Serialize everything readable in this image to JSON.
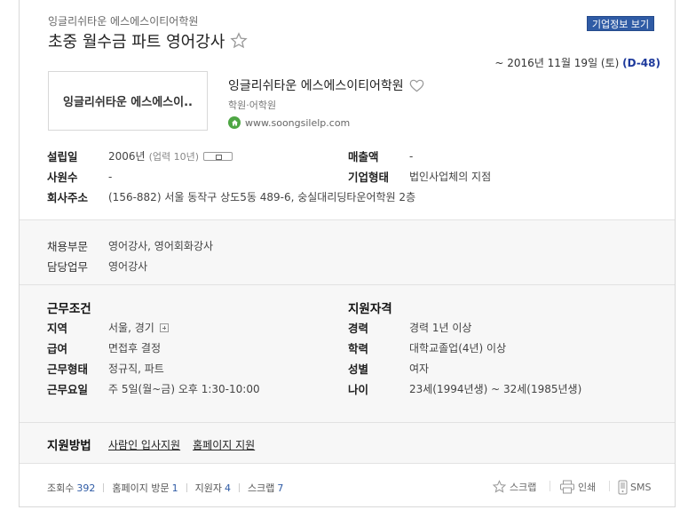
{
  "header": {
    "company_small": "잉글리쉬타운 에스에스이티어학원",
    "job_title": "초중 월수금 파트 영어강사",
    "company_info_button": "기업정보 보기",
    "deadline_prefix": "~ 2016년 11월 19일 (토)",
    "dday": "(D-48)"
  },
  "company": {
    "logo_text": "잉글리쉬타운 에스에스이..",
    "name": "잉글리쉬타운 에스에스이티어학원",
    "category": "학원·어학원",
    "website": "www.soongsilelp.com"
  },
  "overview": {
    "founded_label": "설립일",
    "founded_value": "2006년",
    "founded_years": "(업력 10년)",
    "revenue_label": "매출액",
    "revenue_value": "-",
    "employees_label": "사원수",
    "employees_value": "-",
    "corp_type_label": "기업형태",
    "corp_type_value": "법인사업체의 지점",
    "address_label": "회사주소",
    "address_value": "(156-882) 서울 동작구 상도5동 489-6, 숭실대리딩타운어학원 2층"
  },
  "duty": {
    "dept_label": "채용부문",
    "dept_value": "영어강사, 영어회화강사",
    "task_label": "담당업무",
    "task_value": "영어강사"
  },
  "conditions": {
    "heading": "근무조건",
    "region_label": "지역",
    "region_value": "서울, 경기",
    "salary_label": "급여",
    "salary_value": "면접후 결정",
    "type_label": "근무형태",
    "type_value": "정규직, 파트",
    "days_label": "근무요일",
    "days_value": "주 5일(월~금) 오후 1:30-10:00"
  },
  "qualifications": {
    "heading": "지원자격",
    "career_label": "경력",
    "career_value": "경력 1년 이상",
    "edu_label": "학력",
    "edu_value": "대학교졸업(4년) 이상",
    "gender_label": "성별",
    "gender_value": "여자",
    "age_label": "나이",
    "age_value": "23세(1994년생) ~ 32세(1985년생)"
  },
  "apply": {
    "heading": "지원방법",
    "method1": "사람인 입사지원",
    "method2": "홈페이지 지원"
  },
  "stats": {
    "views_label": "조회수",
    "views": "392",
    "homepage_label": "홈페이지 방문",
    "homepage": "1",
    "applicants_label": "지원자",
    "applicants": "4",
    "scraps_label": "스크랩",
    "scraps": "7"
  },
  "actions": {
    "scrap": "스크랩",
    "print": "인쇄",
    "sms": "SMS"
  },
  "colors": {
    "accent": "#2f5ba5",
    "dday": "#1e3a9c",
    "homepage_icon": "#4ea644"
  }
}
